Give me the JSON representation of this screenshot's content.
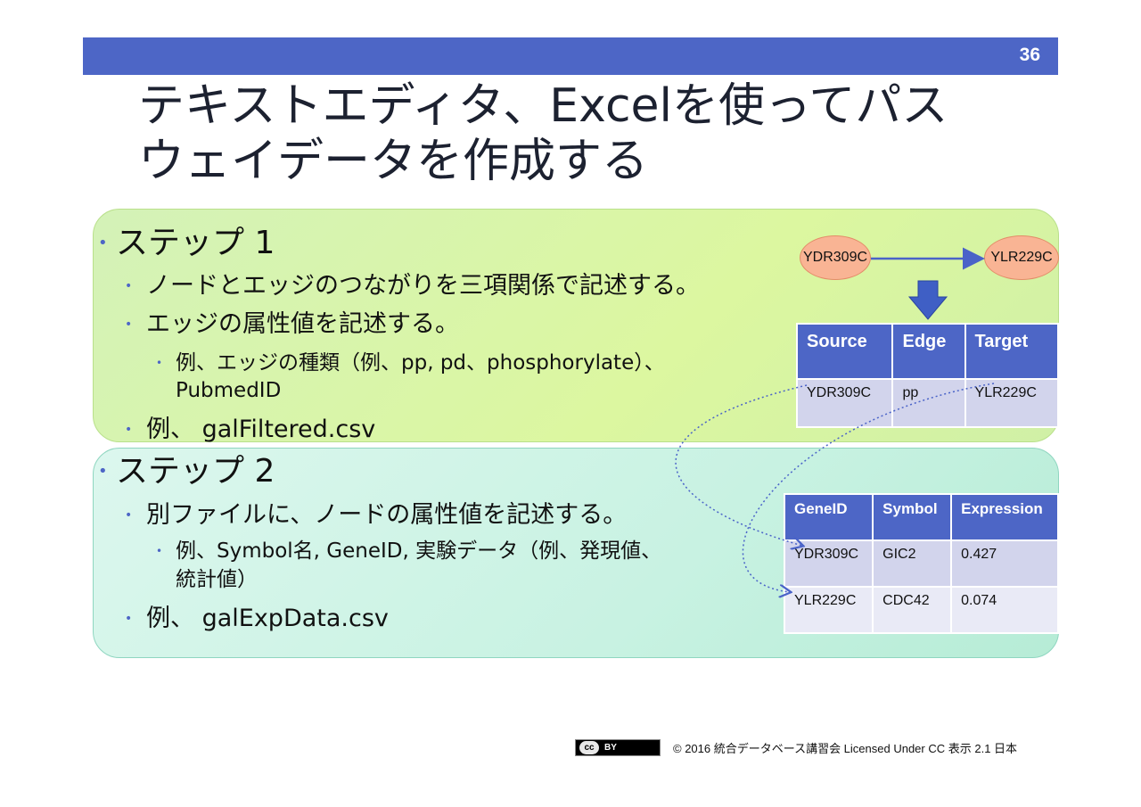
{
  "page": {
    "number": "36"
  },
  "title": {
    "line1": "テキストエディタ、Excelを使ってパス",
    "line2": "ウェイデータを作成する"
  },
  "step1": {
    "heading": "ステップ 1",
    "bullets": [
      "ノードとエッジのつながりを三項関係で記述する。",
      "エッジの属性値を記述する。"
    ],
    "sub": {
      "line1": "例、エッジの種類（例、pp, pd、phosphorylate）、",
      "line2": "PubmedID"
    },
    "example": "例、 galFiltered.csv"
  },
  "step2": {
    "heading": "ステップ 2",
    "bullet": "別ファイルに、ノードの属性値を記述する。",
    "sub": {
      "line1": "例、Symbol名, GeneID, 実験データ（例、発現値、",
      "line2": "統計値）"
    },
    "example": "例、 galExpData.csv"
  },
  "diagram": {
    "source_node": "YDR309C",
    "target_node": "YLR229C",
    "colors": {
      "node_fill": "#f9b494",
      "arrow": "#4a63c8",
      "down_arrow": "#3f5fc5"
    }
  },
  "edge_table": {
    "headers": [
      "Source",
      "Edge",
      "Target"
    ],
    "rows": [
      [
        "YDR309C",
        "pp",
        "YLR229C"
      ]
    ]
  },
  "node_table": {
    "headers": [
      "GeneID",
      "Symbol",
      "Expression"
    ],
    "rows": [
      [
        "YDR309C",
        "GIC2",
        "0.427"
      ],
      [
        "YLR229C",
        "CDC42",
        "0.074"
      ]
    ]
  },
  "footer": {
    "cc_logo": "cc",
    "cc_by": "BY",
    "text": "© 2016  統合データベース講習会 Licensed Under CC 表示 2.1 日本"
  },
  "colors": {
    "accent": "#4d66c6",
    "step1_bg": "#dcf7a0",
    "step2_bg": "#c8f2e2",
    "table_cell": "#d2d4ec"
  }
}
